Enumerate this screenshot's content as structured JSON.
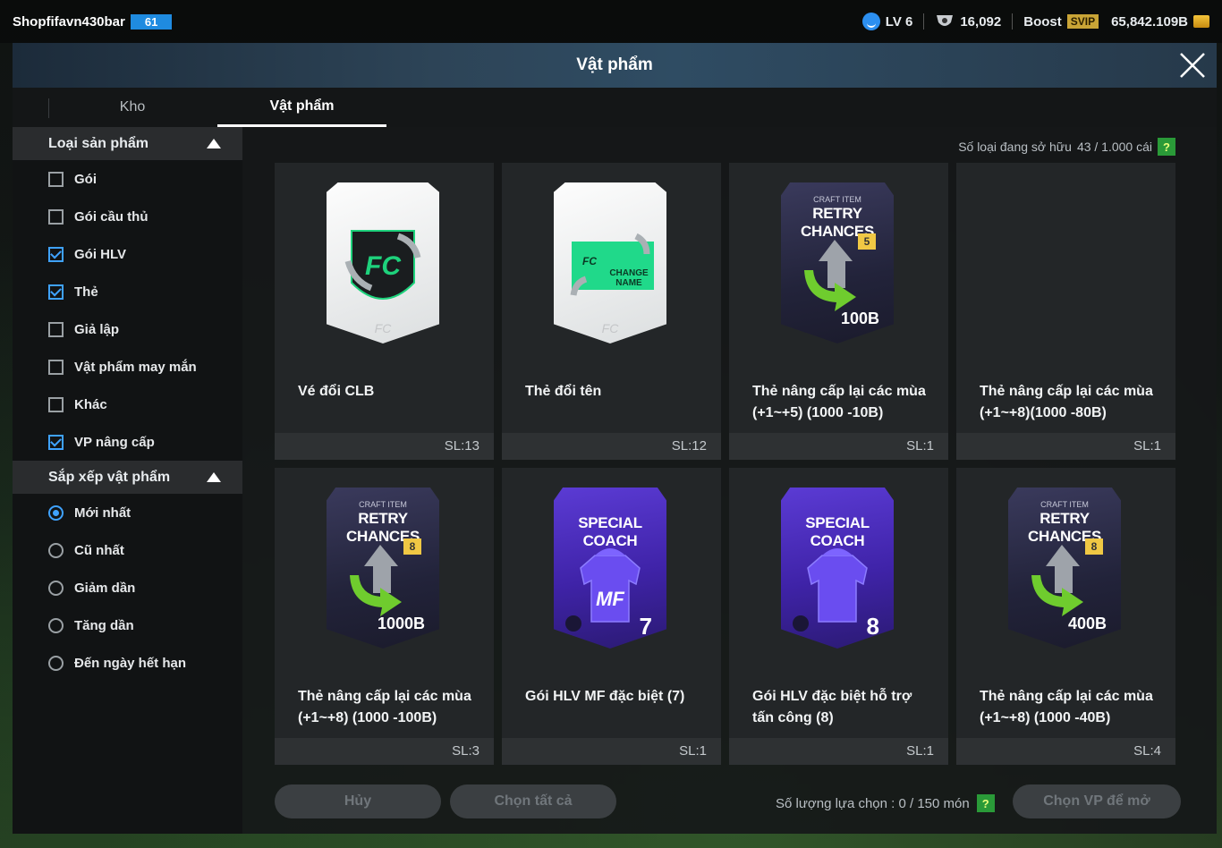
{
  "topbar": {
    "username": "Shopfifavn430bar",
    "user_level_badge": "61",
    "level": "LV 6",
    "points": "16,092",
    "boost_label": "Boost",
    "svip_label": "SVIP",
    "balance": "65,842.109B"
  },
  "header": {
    "title": "Vật phẩm"
  },
  "tabs": [
    {
      "label": "Kho",
      "active": false
    },
    {
      "label": "Vật phẩm",
      "active": true
    }
  ],
  "sidebar": {
    "product_type_title": "Loại sản phẩm",
    "filters": [
      {
        "label": "Gói",
        "checked": false
      },
      {
        "label": "Gói cầu thủ",
        "checked": false
      },
      {
        "label": "Gói HLV",
        "checked": true
      },
      {
        "label": "Thẻ",
        "checked": true
      },
      {
        "label": "Giả lập",
        "checked": false
      },
      {
        "label": "Vật phẩm may mắn",
        "checked": false
      },
      {
        "label": "Khác",
        "checked": false
      },
      {
        "label": "VP nâng cấp",
        "checked": true
      }
    ],
    "sort_title": "Sắp xếp vật phẩm",
    "sort_options": [
      {
        "label": "Mới nhất",
        "selected": true
      },
      {
        "label": "Cũ nhất",
        "selected": false
      },
      {
        "label": "Giảm dần",
        "selected": false
      },
      {
        "label": "Tăng dần",
        "selected": false
      },
      {
        "label": "Đến ngày hết hạn",
        "selected": false
      }
    ]
  },
  "owned": {
    "label": "Số loại đang sở hữu",
    "value": "43 / 1.000 cái",
    "help": "?"
  },
  "items": [
    {
      "name_line1": "Vé đổi CLB",
      "name_line2": "",
      "qty": "SL:13",
      "art": "club-ticket"
    },
    {
      "name_line1": "Thẻ đổi tên",
      "name_line2": "",
      "qty": "SL:12",
      "art": "rename-card",
      "art_text": "CHANGE NAME"
    },
    {
      "name_line1": "Thẻ nâng cấp lại các mùa",
      "name_line2": "(+1~+5) (1000 -10B)",
      "qty": "SL:1",
      "art": "retry",
      "art_small": "CRAFT ITEM",
      "art_title": "RETRY CHANCES",
      "art_badge": "5",
      "art_value": "100B"
    },
    {
      "name_line1": "Thẻ nâng cấp lại các mùa",
      "name_line2": "(+1~+8)(1000 -80B)",
      "qty": "SL:1",
      "art": "none"
    },
    {
      "name_line1": "Thẻ nâng cấp lại các mùa",
      "name_line2": "(+1~+8) (1000 -100B)",
      "qty": "SL:3",
      "art": "retry",
      "art_small": "CRAFT ITEM",
      "art_title": "RETRY CHANCES",
      "art_badge": "8",
      "art_value": "1000B"
    },
    {
      "name_line1": "Gói HLV MF đặc biệt (7)",
      "name_line2": "",
      "qty": "SL:1",
      "art": "coach",
      "art_title": "SPECIAL COACH",
      "art_num": "7",
      "art_mf": "MF"
    },
    {
      "name_line1": "Gói HLV đặc biệt hỗ trợ",
      "name_line2": "tấn công (8)",
      "qty": "SL:1",
      "art": "coach",
      "art_title": "SPECIAL COACH",
      "art_num": "8",
      "art_mf": ""
    },
    {
      "name_line1": "Thẻ nâng cấp lại các mùa",
      "name_line2": "(+1~+8) (1000 -40B)",
      "qty": "SL:4",
      "art": "retry",
      "art_small": "CRAFT ITEM",
      "art_title": "RETRY CHANCES",
      "art_badge": "8",
      "art_value": "400B"
    }
  ],
  "bottom": {
    "cancel_label": "Hủy",
    "select_all_label": "Chọn tất cả",
    "selection_label": "Số lượng lựa chọn : 0 / 150 món",
    "help": "?",
    "open_label": "Chọn VP để mở"
  },
  "colors": {
    "accent": "#3fa2ff",
    "help_green": "#2a9a38",
    "coach_purple": "#4a2bc0"
  }
}
